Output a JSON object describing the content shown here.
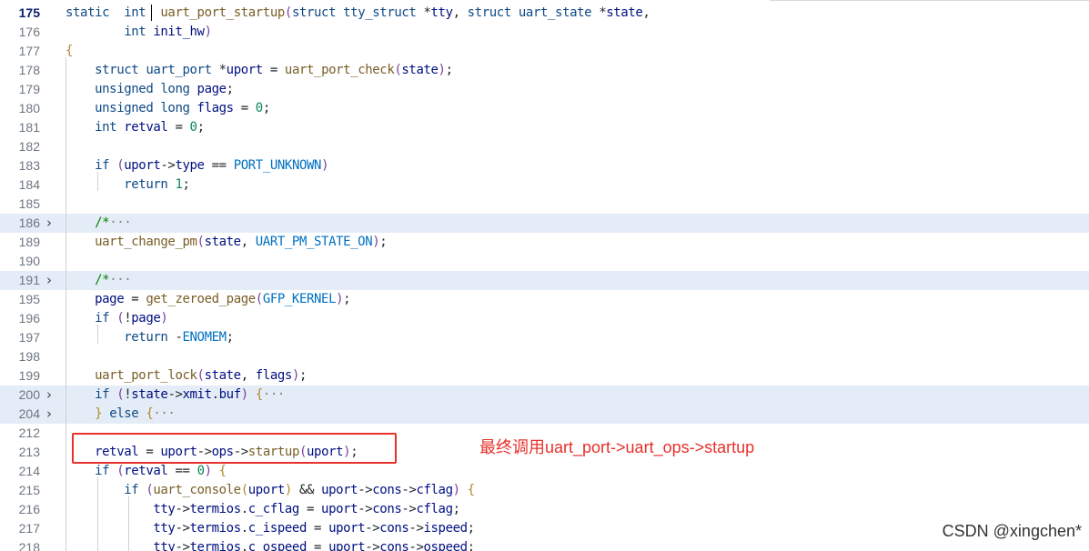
{
  "editor": {
    "lines": [
      {
        "num": "175",
        "current": true,
        "fold": false,
        "tokens": [
          [
            "kw",
            "static"
          ],
          [
            "",
            "  "
          ],
          [
            "ty",
            "int"
          ],
          [
            "",
            "  "
          ],
          [
            "fn",
            "uart_port_startup"
          ],
          [
            "par",
            "("
          ],
          [
            "kw",
            "struct"
          ],
          [
            "",
            " "
          ],
          [
            "ty",
            "tty_struct"
          ],
          [
            "",
            " *"
          ],
          [
            "id",
            "tty"
          ],
          [
            "",
            ", "
          ],
          [
            "kw",
            "struct"
          ],
          [
            "",
            " "
          ],
          [
            "ty",
            "uart_state"
          ],
          [
            "",
            " *"
          ],
          [
            "id",
            "state"
          ],
          [
            "",
            ","
          ]
        ]
      },
      {
        "num": "176",
        "fold": false,
        "tokens": [
          [
            "",
            "        "
          ],
          [
            "ty",
            "int"
          ],
          [
            "",
            " "
          ],
          [
            "id",
            "init_hw"
          ],
          [
            "par",
            ")"
          ]
        ]
      },
      {
        "num": "177",
        "fold": false,
        "tokens": [
          [
            "par2",
            "{"
          ]
        ]
      },
      {
        "num": "178",
        "fold": false,
        "tokens": [
          [
            "",
            "    "
          ],
          [
            "kw",
            "struct"
          ],
          [
            "",
            " "
          ],
          [
            "ty",
            "uart_port"
          ],
          [
            "",
            " *"
          ],
          [
            "id",
            "uport"
          ],
          [
            "",
            " = "
          ],
          [
            "fn",
            "uart_port_check"
          ],
          [
            "par",
            "("
          ],
          [
            "id",
            "state"
          ],
          [
            "par",
            ")"
          ],
          [
            "",
            ";"
          ]
        ]
      },
      {
        "num": "179",
        "fold": false,
        "tokens": [
          [
            "",
            "    "
          ],
          [
            "kw",
            "unsigned"
          ],
          [
            "",
            " "
          ],
          [
            "kw",
            "long"
          ],
          [
            "",
            " "
          ],
          [
            "id",
            "page"
          ],
          [
            "",
            ";"
          ]
        ]
      },
      {
        "num": "180",
        "fold": false,
        "tokens": [
          [
            "",
            "    "
          ],
          [
            "kw",
            "unsigned"
          ],
          [
            "",
            " "
          ],
          [
            "kw",
            "long"
          ],
          [
            "",
            " "
          ],
          [
            "id",
            "flags"
          ],
          [
            "",
            " = "
          ],
          [
            "num",
            "0"
          ],
          [
            "",
            ";"
          ]
        ]
      },
      {
        "num": "181",
        "fold": false,
        "tokens": [
          [
            "",
            "    "
          ],
          [
            "ty",
            "int"
          ],
          [
            "",
            " "
          ],
          [
            "id",
            "retval"
          ],
          [
            "",
            " = "
          ],
          [
            "num",
            "0"
          ],
          [
            "",
            ";"
          ]
        ]
      },
      {
        "num": "182",
        "fold": false,
        "tokens": []
      },
      {
        "num": "183",
        "fold": false,
        "tokens": [
          [
            "",
            "    "
          ],
          [
            "kw",
            "if"
          ],
          [
            "",
            " "
          ],
          [
            "par",
            "("
          ],
          [
            "id",
            "uport"
          ],
          [
            "",
            "->"
          ],
          [
            "id",
            "type"
          ],
          [
            "",
            " == "
          ],
          [
            "const",
            "PORT_UNKNOWN"
          ],
          [
            "par",
            ")"
          ]
        ]
      },
      {
        "num": "184",
        "fold": false,
        "tokens": [
          [
            "",
            "        "
          ],
          [
            "kw",
            "return"
          ],
          [
            "",
            " "
          ],
          [
            "num",
            "1"
          ],
          [
            "",
            ";"
          ]
        ]
      },
      {
        "num": "185",
        "fold": false,
        "tokens": []
      },
      {
        "num": "186",
        "fold": true,
        "tokens": [
          [
            "",
            "    "
          ],
          [
            "cm",
            "/*"
          ],
          [
            "fold-dots",
            "···"
          ]
        ]
      },
      {
        "num": "189",
        "fold": false,
        "tokens": [
          [
            "",
            "    "
          ],
          [
            "fn",
            "uart_change_pm"
          ],
          [
            "par",
            "("
          ],
          [
            "id",
            "state"
          ],
          [
            "",
            ", "
          ],
          [
            "const",
            "UART_PM_STATE_ON"
          ],
          [
            "par",
            ")"
          ],
          [
            "",
            ";"
          ]
        ]
      },
      {
        "num": "190",
        "fold": false,
        "tokens": []
      },
      {
        "num": "191",
        "fold": true,
        "tokens": [
          [
            "",
            "    "
          ],
          [
            "cm",
            "/*"
          ],
          [
            "fold-dots",
            "···"
          ]
        ]
      },
      {
        "num": "195",
        "fold": false,
        "tokens": [
          [
            "",
            "    "
          ],
          [
            "id",
            "page"
          ],
          [
            "",
            " = "
          ],
          [
            "fn",
            "get_zeroed_page"
          ],
          [
            "par",
            "("
          ],
          [
            "const",
            "GFP_KERNEL"
          ],
          [
            "par",
            ")"
          ],
          [
            "",
            ";"
          ]
        ]
      },
      {
        "num": "196",
        "fold": false,
        "tokens": [
          [
            "",
            "    "
          ],
          [
            "kw",
            "if"
          ],
          [
            "",
            " "
          ],
          [
            "par",
            "("
          ],
          [
            "",
            "!"
          ],
          [
            "id",
            "page"
          ],
          [
            "par",
            ")"
          ]
        ]
      },
      {
        "num": "197",
        "fold": false,
        "tokens": [
          [
            "",
            "        "
          ],
          [
            "kw",
            "return"
          ],
          [
            "",
            " -"
          ],
          [
            "const",
            "ENOMEM"
          ],
          [
            "",
            ";"
          ]
        ]
      },
      {
        "num": "198",
        "fold": false,
        "tokens": []
      },
      {
        "num": "199",
        "fold": false,
        "tokens": [
          [
            "",
            "    "
          ],
          [
            "fn",
            "uart_port_lock"
          ],
          [
            "par",
            "("
          ],
          [
            "id",
            "state"
          ],
          [
            "",
            ", "
          ],
          [
            "id",
            "flags"
          ],
          [
            "par",
            ")"
          ],
          [
            "",
            ";"
          ]
        ]
      },
      {
        "num": "200",
        "fold": true,
        "tokens": [
          [
            "",
            "    "
          ],
          [
            "kw",
            "if"
          ],
          [
            "",
            " "
          ],
          [
            "par",
            "("
          ],
          [
            "",
            "!"
          ],
          [
            "id",
            "state"
          ],
          [
            "",
            "->"
          ],
          [
            "id",
            "xmit"
          ],
          [
            "",
            "."
          ],
          [
            "id",
            "buf"
          ],
          [
            "par",
            ")"
          ],
          [
            "",
            " "
          ],
          [
            "par2",
            "{"
          ],
          [
            "fold-dots",
            "···"
          ]
        ]
      },
      {
        "num": "204",
        "fold": true,
        "tokens": [
          [
            "",
            "    "
          ],
          [
            "par2",
            "}"
          ],
          [
            "",
            " "
          ],
          [
            "kw",
            "else"
          ],
          [
            "",
            " "
          ],
          [
            "par2",
            "{"
          ],
          [
            "fold-dots",
            "···"
          ]
        ]
      },
      {
        "num": "212",
        "fold": false,
        "tokens": []
      },
      {
        "num": "213",
        "fold": false,
        "tokens": [
          [
            "",
            "    "
          ],
          [
            "id",
            "retval"
          ],
          [
            "",
            " = "
          ],
          [
            "id",
            "uport"
          ],
          [
            "",
            "->"
          ],
          [
            "id",
            "ops"
          ],
          [
            "",
            "->"
          ],
          [
            "fn",
            "startup"
          ],
          [
            "par",
            "("
          ],
          [
            "id",
            "uport"
          ],
          [
            "par",
            ")"
          ],
          [
            "",
            ";"
          ]
        ]
      },
      {
        "num": "214",
        "fold": false,
        "tokens": [
          [
            "",
            "    "
          ],
          [
            "kw",
            "if"
          ],
          [
            "",
            " "
          ],
          [
            "par",
            "("
          ],
          [
            "id",
            "retval"
          ],
          [
            "",
            " == "
          ],
          [
            "num",
            "0"
          ],
          [
            "par",
            ")"
          ],
          [
            "",
            " "
          ],
          [
            "par2",
            "{"
          ]
        ]
      },
      {
        "num": "215",
        "fold": false,
        "tokens": [
          [
            "",
            "        "
          ],
          [
            "kw",
            "if"
          ],
          [
            "",
            " "
          ],
          [
            "par",
            "("
          ],
          [
            "fn",
            "uart_console"
          ],
          [
            "par2",
            "("
          ],
          [
            "id",
            "uport"
          ],
          [
            "par2",
            ")"
          ],
          [
            "",
            " && "
          ],
          [
            "id",
            "uport"
          ],
          [
            "",
            "->"
          ],
          [
            "id",
            "cons"
          ],
          [
            "",
            "->"
          ],
          [
            "id",
            "cflag"
          ],
          [
            "par",
            ")"
          ],
          [
            "",
            " "
          ],
          [
            "par2",
            "{"
          ]
        ]
      },
      {
        "num": "216",
        "fold": false,
        "tokens": [
          [
            "",
            "            "
          ],
          [
            "id",
            "tty"
          ],
          [
            "",
            "->"
          ],
          [
            "id",
            "termios"
          ],
          [
            "",
            "."
          ],
          [
            "id",
            "c_cflag"
          ],
          [
            "",
            " = "
          ],
          [
            "id",
            "uport"
          ],
          [
            "",
            "->"
          ],
          [
            "id",
            "cons"
          ],
          [
            "",
            "->"
          ],
          [
            "id",
            "cflag"
          ],
          [
            "",
            ";"
          ]
        ]
      },
      {
        "num": "217",
        "fold": false,
        "tokens": [
          [
            "",
            "            "
          ],
          [
            "id",
            "tty"
          ],
          [
            "",
            "->"
          ],
          [
            "id",
            "termios"
          ],
          [
            "",
            "."
          ],
          [
            "id",
            "c_ispeed"
          ],
          [
            "",
            " = "
          ],
          [
            "id",
            "uport"
          ],
          [
            "",
            "->"
          ],
          [
            "id",
            "cons"
          ],
          [
            "",
            "->"
          ],
          [
            "id",
            "ispeed"
          ],
          [
            "",
            ";"
          ]
        ]
      },
      {
        "num": "218",
        "fold": false,
        "tokens": [
          [
            "",
            "            "
          ],
          [
            "id",
            "tty"
          ],
          [
            "",
            "->"
          ],
          [
            "id",
            "termios"
          ],
          [
            "",
            "."
          ],
          [
            "id",
            "c_ospeed"
          ],
          [
            "",
            " = "
          ],
          [
            "id",
            "uport"
          ],
          [
            "",
            "->"
          ],
          [
            "id",
            "cons"
          ],
          [
            "",
            "->"
          ],
          [
            "id",
            "ospeed"
          ],
          [
            "",
            ";"
          ]
        ]
      }
    ]
  },
  "annotation": {
    "text": "最终调用uart_port->uart_ops->startup"
  },
  "watermark": {
    "text": "CSDN @xingchen*"
  },
  "colors": {
    "highlight_box": "#e8312b",
    "fold_line_bg": "#e4edf7"
  }
}
